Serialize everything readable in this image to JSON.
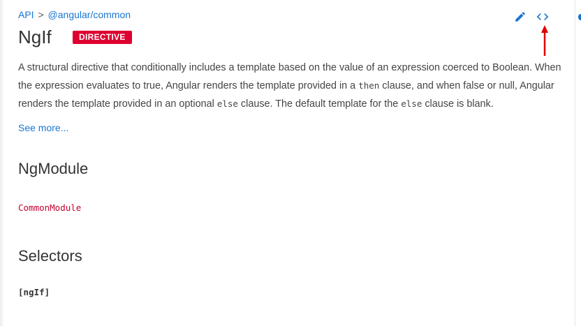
{
  "breadcrumb": {
    "root": "API",
    "separator": ">",
    "package": "@angular/common"
  },
  "header": {
    "title": "NgIf",
    "badge": "DIRECTIVE"
  },
  "toolbar": {
    "edit_icon": "pencil-icon",
    "source_icon": "code-brackets-icon"
  },
  "description": {
    "part1": "A structural directive that conditionally includes a template based on the value of an expression coerced to Boolean. When the expression evaluates to true, Angular renders the template provided in a ",
    "code1": "then",
    "part2": " clause, and when false or null, Angular renders the template provided in an optional ",
    "code2": "else",
    "part3": " clause. The default template for the ",
    "code3": "else",
    "part4": " clause is blank."
  },
  "see_more": "See more...",
  "ngmodule": {
    "heading": "NgModule",
    "module": "CommonModule"
  },
  "selectors": {
    "heading": "Selectors",
    "value": "[ngIf]"
  },
  "colors": {
    "link": "#1976d2",
    "badge": "#dd0031",
    "module_link": "#c3002f",
    "annotation_arrow": "#e00000"
  }
}
